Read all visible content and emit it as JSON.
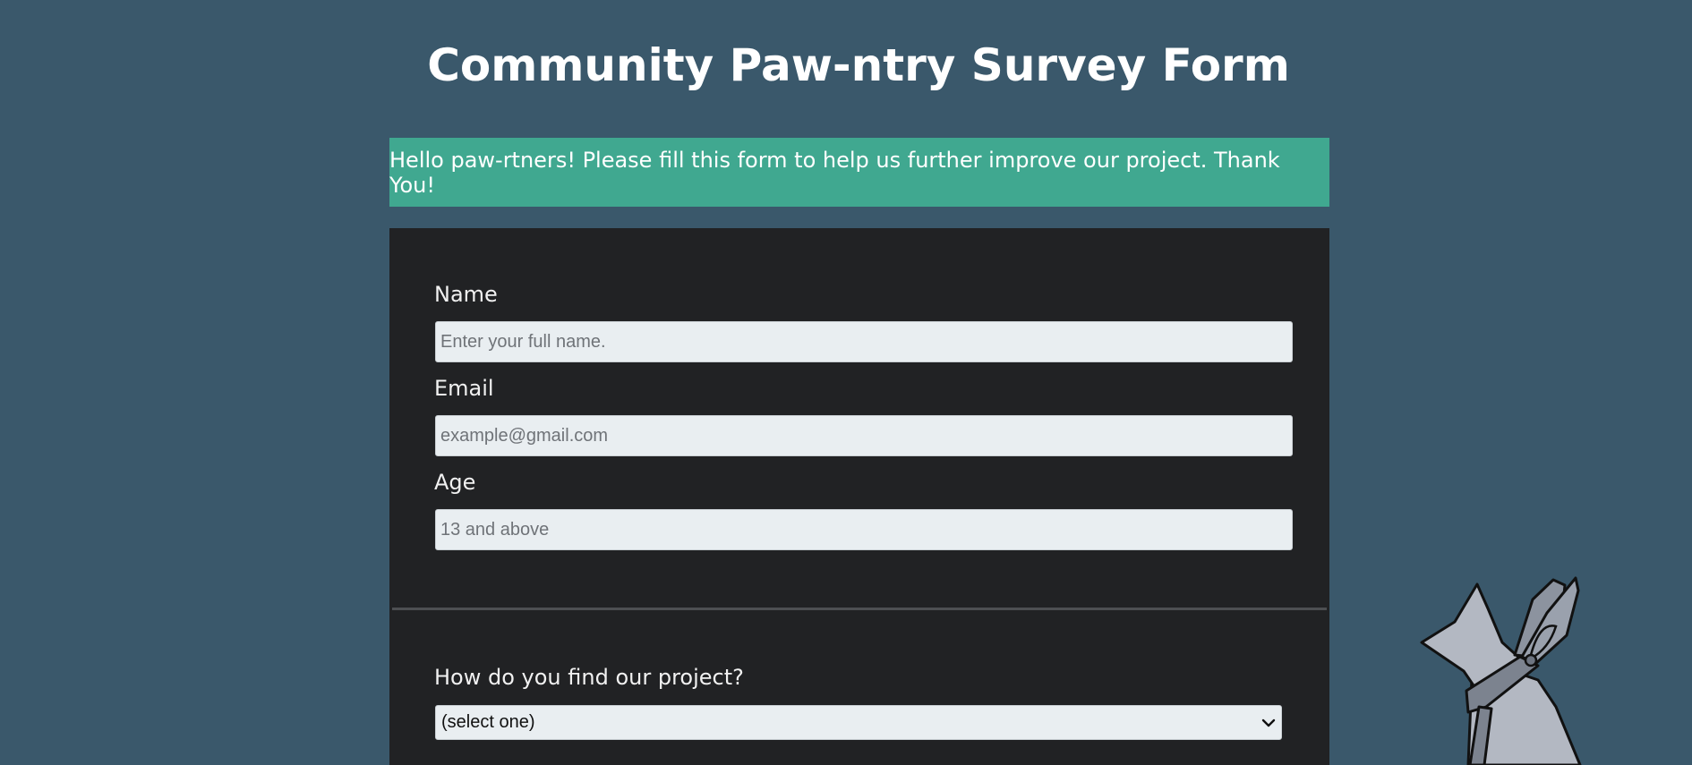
{
  "page": {
    "title": "Community Paw-ntry Survey Form",
    "banner": "Hello paw-rtners! Please fill this form to help us further improve our project. Thank You!"
  },
  "form": {
    "name": {
      "label": "Name",
      "placeholder": "Enter your full name."
    },
    "email": {
      "label": "Email",
      "placeholder": "example@gmail.com"
    },
    "age": {
      "label": "Age",
      "placeholder": "13 and above"
    },
    "project_opinion": {
      "label": "How do you find our project?",
      "selected": "(select one)"
    }
  },
  "colors": {
    "background": "#3a586b",
    "banner": "#40a890",
    "form_panel": "#212224",
    "input_bg": "#e9eef1"
  },
  "icons": {
    "select_arrow": "chevron-down-icon",
    "mascot": "cat-mascot-icon"
  }
}
